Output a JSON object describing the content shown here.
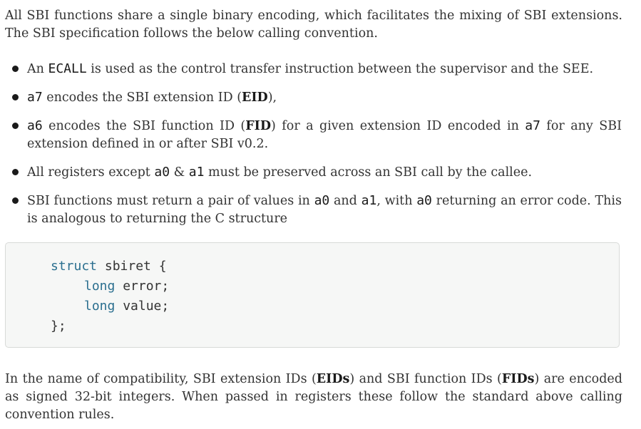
{
  "intro": {
    "text": "All SBI functions share a single binary encoding, which facilitates the mixing of SBI extensions. The SBI specification follows the below calling convention."
  },
  "bullets": [
    {
      "pre": "An ",
      "code1": "ECALL",
      "post": " is used as the control transfer instruction between the supervisor and the SEE."
    },
    {
      "code1": "a7",
      "pre": " encodes the SBI extension ID (",
      "bold": "EID",
      "post": "),"
    },
    {
      "code1": "a6",
      "pre": " encodes the SBI function ID (",
      "bold": "FID",
      "mid": ") for a given extension ID encoded in ",
      "code2": "a7",
      "post": " for any SBI extension defined in or after SBI v0.2."
    },
    {
      "pre": "All registers except ",
      "code1": "a0",
      "mid": " & ",
      "code2": "a1",
      "post": " must be preserved across an SBI call by the callee."
    },
    {
      "pre": "SBI functions must return a pair of values in ",
      "code1": "a0",
      "mid": " and ",
      "code2": "a1",
      "mid2": ", with ",
      "code3": "a0",
      "post": " returning an error code. This is analogous to returning the C structure"
    }
  ],
  "code": {
    "line1_kw": "struct",
    "line1_rest": " sbiret {",
    "line2_kw": "long",
    "line2_rest": " error;",
    "line3_kw": "long",
    "line3_rest": " value;",
    "line4": "};"
  },
  "closing": {
    "pre": "In the name of compatibility, SBI extension IDs (",
    "bold1": "EIDs",
    "mid": ") and SBI function IDs (",
    "bold2": "FIDs",
    "post": ") are encoded as signed 32-bit integers. When passed in registers these follow the standard above calling convention rules."
  }
}
